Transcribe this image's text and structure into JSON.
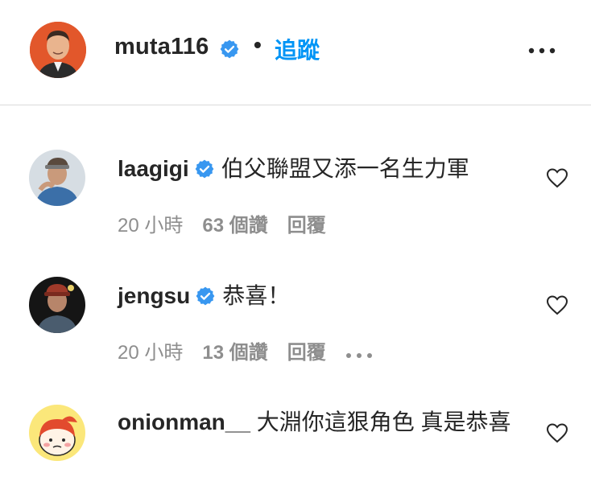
{
  "header": {
    "username": "muta116",
    "separator": "•",
    "follow_label": "追蹤"
  },
  "comments": [
    {
      "username": "laagigi",
      "verified": true,
      "text": "伯父聯盟又添一名生力軍",
      "time": "20 小時",
      "likes": "63 個讚",
      "reply_label": "回覆"
    },
    {
      "username": "jengsu",
      "verified": true,
      "text": "恭喜！",
      "time": "20 小時",
      "likes": "13 個讚",
      "reply_label": "回覆"
    },
    {
      "username": "onionman__",
      "verified": false,
      "text": "大淵你這狠角色 真是恭喜"
    }
  ],
  "colors": {
    "accent": "#0095f6",
    "verified_badge": "#3897f0",
    "text_primary": "#262626",
    "text_secondary": "#8e8e8e",
    "divider": "#dbdbdb"
  },
  "icons": {
    "verified": "verified-badge-icon",
    "more": "more-horizontal-icon",
    "like": "heart-outline-icon"
  }
}
